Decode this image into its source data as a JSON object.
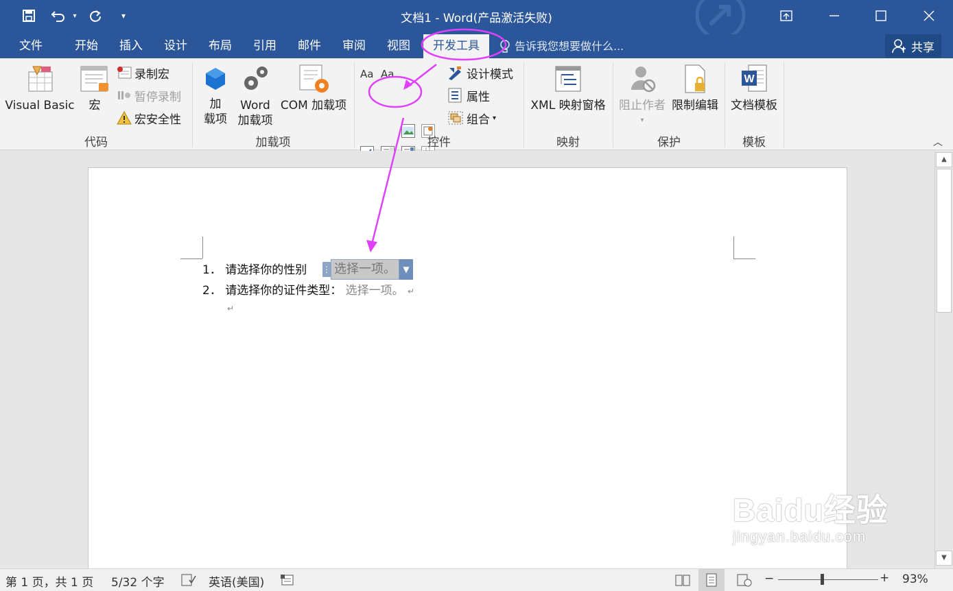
{
  "window": {
    "title": "文档1 - Word(产品激活失败)"
  },
  "tabs": [
    "文件",
    "开始",
    "插入",
    "设计",
    "布局",
    "引用",
    "邮件",
    "审阅",
    "视图",
    "开发工具"
  ],
  "tell_me": "告诉我您想要做什么...",
  "share_label": "共享",
  "ribbon": {
    "code": {
      "visual_basic": "Visual Basic",
      "macros": "宏",
      "record_macro": "录制宏",
      "pause_recording": "暂停录制",
      "macro_security": "宏安全性",
      "label": "代码"
    },
    "addins": {
      "addins_line1": "加",
      "addins_line2": "载项",
      "word_addins_line1": "Word",
      "word_addins_line2": "加载项",
      "com_addins": "COM 加载项",
      "label": "加载项"
    },
    "controls": {
      "design_mode": "设计模式",
      "properties": "属性",
      "group": "组合",
      "label": "控件"
    },
    "mapping": {
      "xml_pane": "XML 映射窗格",
      "label": "映射"
    },
    "protect": {
      "block_authors": "阻止作者",
      "restrict_editing": "限制编辑",
      "label": "保护"
    },
    "templates": {
      "doc_template": "文档模板",
      "label": "模板"
    }
  },
  "document": {
    "line1_num": "1．",
    "line1_text": "请选择你的性别",
    "dropdown_placeholder": "选择一项。",
    "line2_num": "2．",
    "line2_text": "请选择你的证件类型：",
    "line2_placeholder": "选择一项。",
    "para_mark": "↵"
  },
  "status": {
    "page": "第 1 页，共 1 页",
    "words": "5/32 个字",
    "language": "英语(美国)",
    "zoom": "93%"
  },
  "watermark": {
    "logo": "Baidu经验",
    "url": "jingyan.baidu.com"
  },
  "colors": {
    "brand": "#2b579a",
    "annotation": "#e040fb"
  }
}
